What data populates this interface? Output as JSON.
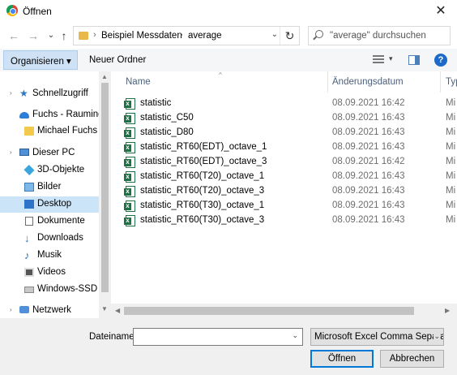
{
  "window": {
    "title": "Öffnen",
    "close_glyph": "✕"
  },
  "nav": {
    "back": "←",
    "forward": "→",
    "recent": "⌄",
    "up": "↑"
  },
  "address": {
    "separator": "›",
    "segments": [
      "Beispiel Messdaten",
      "average"
    ],
    "dropdown": "⌄",
    "refresh": "↻"
  },
  "search": {
    "placeholder": "\"average\" durchsuchen"
  },
  "toolbar": {
    "organize": "Organisieren ▾",
    "new_folder": "Neuer Ordner",
    "view_dd": "▾",
    "help": "?"
  },
  "sidebar": {
    "items": [
      {
        "label": "Schnellzugriff",
        "icon": "star-icon"
      },
      {
        "label": "Fuchs - Rauminge",
        "icon": "cloud-icon"
      },
      {
        "label": "Michael Fuchs - (",
        "icon": "folder-icon"
      },
      {
        "label": "Dieser PC",
        "icon": "pc-icon"
      },
      {
        "label": "3D-Objekte",
        "icon": "cube-icon"
      },
      {
        "label": "Bilder",
        "icon": "pictures-icon"
      },
      {
        "label": "Desktop",
        "icon": "desktop-icon",
        "selected": true
      },
      {
        "label": "Dokumente",
        "icon": "documents-icon"
      },
      {
        "label": "Downloads",
        "icon": "download-icon"
      },
      {
        "label": "Musik",
        "icon": "music-icon"
      },
      {
        "label": "Videos",
        "icon": "video-icon"
      },
      {
        "label": "Windows-SSD (C",
        "icon": "drive-icon"
      },
      {
        "label": "Netzwerk",
        "icon": "network-icon"
      }
    ]
  },
  "columns": {
    "name": "Name",
    "date": "Änderungsdatum",
    "type": "Typ"
  },
  "files": [
    {
      "name": "statistic",
      "date": "08.09.2021 16:42",
      "type": "Mi"
    },
    {
      "name": "statistic_C50",
      "date": "08.09.2021 16:43",
      "type": "Mi"
    },
    {
      "name": "statistic_D80",
      "date": "08.09.2021 16:43",
      "type": "Mi"
    },
    {
      "name": "statistic_RT60(EDT)_octave_1",
      "date": "08.09.2021 16:43",
      "type": "Mi"
    },
    {
      "name": "statistic_RT60(EDT)_octave_3",
      "date": "08.09.2021 16:42",
      "type": "Mi"
    },
    {
      "name": "statistic_RT60(T20)_octave_1",
      "date": "08.09.2021 16:43",
      "type": "Mi"
    },
    {
      "name": "statistic_RT60(T20)_octave_3",
      "date": "08.09.2021 16:43",
      "type": "Mi"
    },
    {
      "name": "statistic_RT60(T30)_octave_1",
      "date": "08.09.2021 16:43",
      "type": "Mi"
    },
    {
      "name": "statistic_RT60(T30)_octave_3",
      "date": "08.09.2021 16:43",
      "type": "Mi"
    }
  ],
  "footer": {
    "filename_label": "Dateiname:",
    "filename_value": "",
    "filetype": "Microsoft Excel Comma Separat",
    "open": "Öffnen",
    "cancel": "Abbrechen",
    "dd": "⌄"
  },
  "scroll": {
    "up": "▲",
    "down": "▼",
    "left": "◀",
    "right": "▶"
  }
}
